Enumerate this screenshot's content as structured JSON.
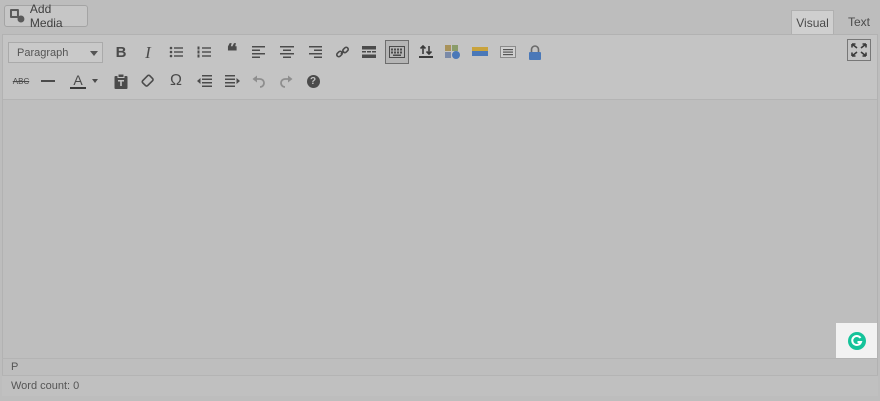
{
  "media": {
    "add_media_label": "Add Media"
  },
  "tabs": [
    {
      "label": "Visual",
      "active": true
    },
    {
      "label": "Text",
      "active": false
    }
  ],
  "toolbar": {
    "format_select": "Paragraph",
    "row1_icons": [
      "bold-icon",
      "italic-icon",
      "bullet-list-icon",
      "numbered-list-icon",
      "blockquote-icon",
      "align-left-icon",
      "align-center-icon",
      "align-right-icon",
      "link-icon",
      "read-more-icon",
      "toolbar-toggle-icon",
      "plugin-upload-icon",
      "plugin-gallery-icon",
      "plugin-media-icon",
      "plugin-list-icon",
      "plugin-lock-icon"
    ],
    "row2_icons": [
      "strikethrough-icon",
      "horizontal-line-icon",
      "text-color-icon",
      "paste-text-icon",
      "clear-formatting-icon",
      "special-character-icon",
      "outdent-icon",
      "indent-icon",
      "undo-icon",
      "redo-icon",
      "help-icon"
    ],
    "bold_glyph": "B",
    "italic_glyph": "I",
    "quote_glyph": "❝",
    "strike_glyph": "ABC",
    "color_glyph": "A",
    "omega_glyph": "Ω",
    "help_glyph": "?"
  },
  "status": {
    "path": "P",
    "word_count": "Word count: 0"
  },
  "colors": {
    "grammarly": "#15c39a",
    "plugin_blue": "#4a78b8",
    "plugin_yellow": "#c9a33c"
  }
}
